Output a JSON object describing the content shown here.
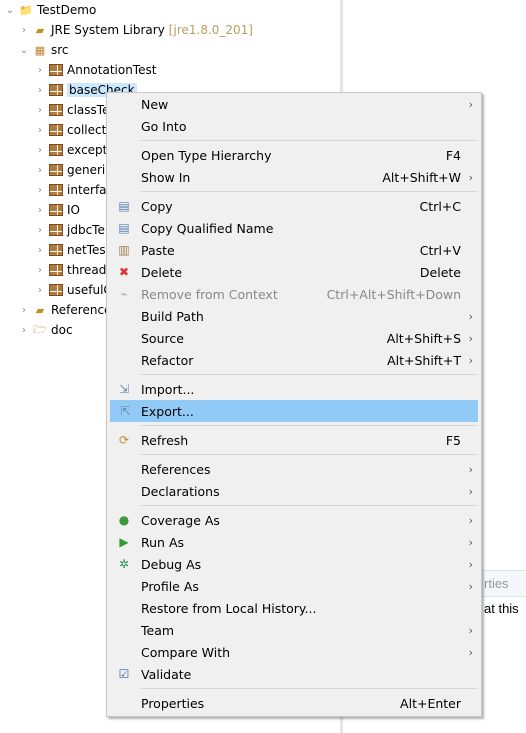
{
  "tree": {
    "items": [
      {
        "label": "TestDemo",
        "level": 0,
        "expanded": true,
        "icon": "project-icon"
      },
      {
        "label": "JRE System Library",
        "decoration": "[jre1.8.0_201]",
        "level": 1,
        "expanded": false,
        "icon": "library-icon"
      },
      {
        "label": "src",
        "level": 1,
        "expanded": true,
        "icon": "source-folder-icon"
      },
      {
        "label": "AnnotationTest",
        "level": 2,
        "icon": "package-icon"
      },
      {
        "label": "baseCheck",
        "level": 2,
        "icon": "package-icon",
        "selected": true
      },
      {
        "label": "classTe",
        "level": 2,
        "icon": "package-icon"
      },
      {
        "label": "collect",
        "level": 2,
        "icon": "package-icon"
      },
      {
        "label": "except",
        "level": 2,
        "icon": "package-icon"
      },
      {
        "label": "generi",
        "level": 2,
        "icon": "package-icon"
      },
      {
        "label": "interfa",
        "level": 2,
        "icon": "package-icon"
      },
      {
        "label": "IO",
        "level": 2,
        "icon": "package-icon"
      },
      {
        "label": "jdbcTe",
        "level": 2,
        "icon": "package-icon"
      },
      {
        "label": "netTes",
        "level": 2,
        "icon": "package-icon"
      },
      {
        "label": "thread",
        "level": 2,
        "icon": "package-icon"
      },
      {
        "label": "usefulC",
        "level": 2,
        "icon": "package-icon"
      },
      {
        "label": "Reference",
        "level": 1,
        "icon": "library-icon"
      },
      {
        "label": "doc",
        "level": 1,
        "icon": "folder-icon"
      }
    ]
  },
  "bottom_panel": {
    "tab_label": "rties",
    "text": "at this"
  },
  "menu": {
    "items": [
      {
        "label": "New",
        "submenu": true
      },
      {
        "label": "Go Into"
      },
      {
        "sep": true
      },
      {
        "label": "Open Type Hierarchy",
        "shortcut": "F4"
      },
      {
        "label": "Show In",
        "shortcut": "Alt+Shift+W",
        "submenu": true
      },
      {
        "sep": true
      },
      {
        "label": "Copy",
        "shortcut": "Ctrl+C",
        "icon": "copy-icon"
      },
      {
        "label": "Copy Qualified Name",
        "icon": "copy-qualified-icon"
      },
      {
        "label": "Paste",
        "shortcut": "Ctrl+V",
        "icon": "paste-icon"
      },
      {
        "label": "Delete",
        "shortcut": "Delete",
        "icon": "delete-icon"
      },
      {
        "label": "Remove from Context",
        "shortcut": "Ctrl+Alt+Shift+Down",
        "icon": "remove-context-icon",
        "disabled": true
      },
      {
        "label": "Build Path",
        "submenu": true
      },
      {
        "label": "Source",
        "shortcut": "Alt+Shift+S",
        "submenu": true
      },
      {
        "label": "Refactor",
        "shortcut": "Alt+Shift+T",
        "submenu": true
      },
      {
        "sep": true
      },
      {
        "label": "Import...",
        "icon": "import-icon"
      },
      {
        "label": "Export...",
        "icon": "export-icon",
        "highlighted": true
      },
      {
        "sep": true
      },
      {
        "label": "Refresh",
        "shortcut": "F5",
        "icon": "refresh-icon"
      },
      {
        "sep": true
      },
      {
        "label": "References",
        "submenu": true
      },
      {
        "label": "Declarations",
        "submenu": true
      },
      {
        "sep": true
      },
      {
        "label": "Coverage As",
        "submenu": true,
        "icon": "coverage-icon"
      },
      {
        "label": "Run As",
        "submenu": true,
        "icon": "run-icon"
      },
      {
        "label": "Debug As",
        "submenu": true,
        "icon": "debug-icon"
      },
      {
        "label": "Profile As",
        "submenu": true
      },
      {
        "label": "Restore from Local History..."
      },
      {
        "label": "Team",
        "submenu": true
      },
      {
        "label": "Compare With",
        "submenu": true
      },
      {
        "label": "Validate",
        "icon": "validate-icon"
      },
      {
        "sep": true
      },
      {
        "label": "Properties",
        "shortcut": "Alt+Enter"
      }
    ]
  }
}
